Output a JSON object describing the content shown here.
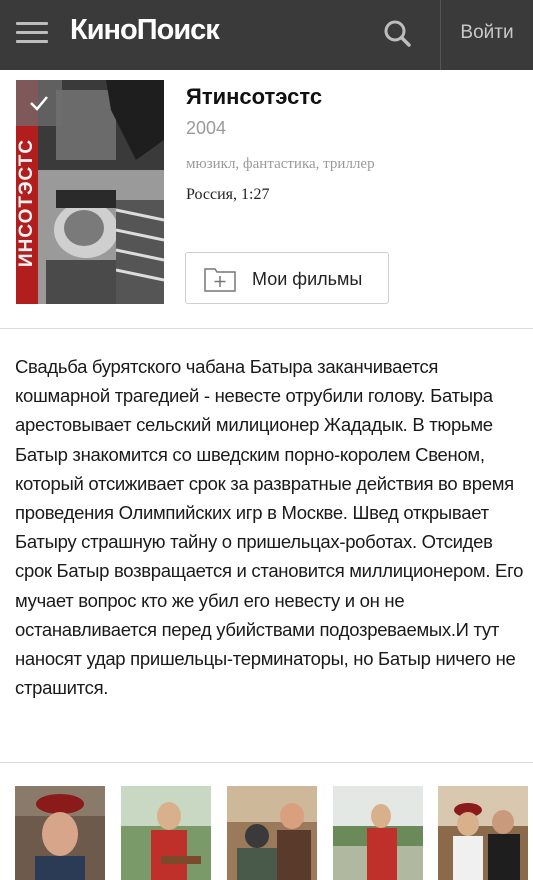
{
  "header": {
    "logo": "КиноПоиск",
    "login_label": "Войти",
    "menu_icon": "hamburger-menu-icon",
    "search_icon": "search-icon",
    "background_color": "#3a3a3a"
  },
  "movie": {
    "title": "Ятинсотэстс",
    "year": "2004",
    "genres": "мюзикл, фантастика, триллер",
    "country_duration": "Россия, 1:27",
    "poster_text": "ИНСОТЭСТС",
    "add_button_label": "Мои фильмы",
    "description": "Свадьба бурятского чабана Батыра заканчивается кошмарной трагедией - невесте отрубили голову. Батыра арестовывает сельский милиционер Жададык. В тюрьме Батыр знакомится со шведским порно-королем Свеном, который отсиживает срок за развратные действия во время проведения Олимпийских игр в Москве. Швед открывает Батыру страшную тайну о пришельцах-роботах. Отсидев срок Батыр возвращается и становится миллиционером. Его мучает вопрос кто же убил его невесту и он не останавливается перед убийствами подозреваемых.И тут наносят удар пришельцы-терминаторы, но Батыр ничего не страшится."
  },
  "stills": [
    {
      "name": "still-1"
    },
    {
      "name": "still-2"
    },
    {
      "name": "still-3"
    },
    {
      "name": "still-4"
    },
    {
      "name": "still-5"
    }
  ]
}
